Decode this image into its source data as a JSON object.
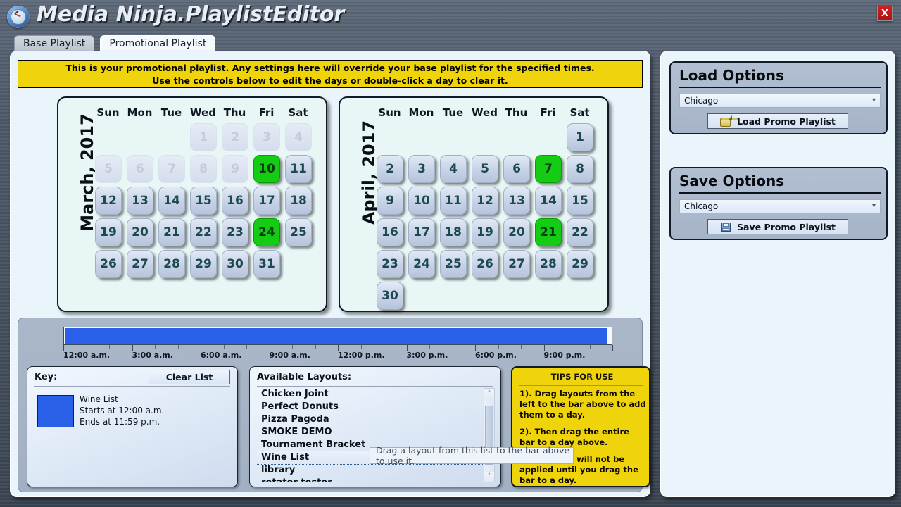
{
  "window": {
    "title": "Media Ninja.PlaylistEditor",
    "app_icon": "clock-icon",
    "close_label": "X"
  },
  "tabs": [
    {
      "label": "Base Playlist",
      "active": false
    },
    {
      "label": "Promotional Playlist",
      "active": true
    }
  ],
  "notice": {
    "line1": "This is your promotional playlist. Any settings here will override your base playlist for the specified times.",
    "line2": "Use the controls below to edit the days or double-click a day to clear it.",
    "background": "#efd40b"
  },
  "calendars": [
    {
      "month_label": "March, 2017",
      "weekday_headers": [
        "Sun",
        "Mon",
        "Tue",
        "Wed",
        "Thu",
        "Fri",
        "Sat"
      ],
      "lead_blanks": 3,
      "days": [
        {
          "n": 1,
          "state": "disabled"
        },
        {
          "n": 2,
          "state": "disabled"
        },
        {
          "n": 3,
          "state": "disabled"
        },
        {
          "n": 4,
          "state": "disabled"
        },
        {
          "n": 5,
          "state": "disabled"
        },
        {
          "n": 6,
          "state": "disabled"
        },
        {
          "n": 7,
          "state": "disabled"
        },
        {
          "n": 8,
          "state": "disabled"
        },
        {
          "n": 9,
          "state": "disabled"
        },
        {
          "n": 10,
          "state": "selected"
        },
        {
          "n": 11,
          "state": "normal"
        },
        {
          "n": 12,
          "state": "normal"
        },
        {
          "n": 13,
          "state": "normal"
        },
        {
          "n": 14,
          "state": "normal"
        },
        {
          "n": 15,
          "state": "normal"
        },
        {
          "n": 16,
          "state": "normal"
        },
        {
          "n": 17,
          "state": "normal"
        },
        {
          "n": 18,
          "state": "normal"
        },
        {
          "n": 19,
          "state": "normal"
        },
        {
          "n": 20,
          "state": "normal"
        },
        {
          "n": 21,
          "state": "normal"
        },
        {
          "n": 22,
          "state": "normal"
        },
        {
          "n": 23,
          "state": "normal"
        },
        {
          "n": 24,
          "state": "selected"
        },
        {
          "n": 25,
          "state": "normal"
        },
        {
          "n": 26,
          "state": "normal"
        },
        {
          "n": 27,
          "state": "normal"
        },
        {
          "n": 28,
          "state": "normal"
        },
        {
          "n": 29,
          "state": "normal"
        },
        {
          "n": 30,
          "state": "normal"
        },
        {
          "n": 31,
          "state": "normal"
        }
      ]
    },
    {
      "month_label": "April, 2017",
      "weekday_headers": [
        "Sun",
        "Mon",
        "Tue",
        "Wed",
        "Thu",
        "Fri",
        "Sat"
      ],
      "lead_blanks": 6,
      "days": [
        {
          "n": 1,
          "state": "normal"
        },
        {
          "n": 2,
          "state": "normal"
        },
        {
          "n": 3,
          "state": "normal"
        },
        {
          "n": 4,
          "state": "normal"
        },
        {
          "n": 5,
          "state": "normal"
        },
        {
          "n": 6,
          "state": "normal"
        },
        {
          "n": 7,
          "state": "selected"
        },
        {
          "n": 8,
          "state": "normal"
        },
        {
          "n": 9,
          "state": "normal"
        },
        {
          "n": 10,
          "state": "normal"
        },
        {
          "n": 11,
          "state": "normal"
        },
        {
          "n": 12,
          "state": "normal"
        },
        {
          "n": 13,
          "state": "normal"
        },
        {
          "n": 14,
          "state": "normal"
        },
        {
          "n": 15,
          "state": "normal"
        },
        {
          "n": 16,
          "state": "normal"
        },
        {
          "n": 17,
          "state": "normal"
        },
        {
          "n": 18,
          "state": "normal"
        },
        {
          "n": 19,
          "state": "normal"
        },
        {
          "n": 20,
          "state": "normal"
        },
        {
          "n": 21,
          "state": "selected"
        },
        {
          "n": 22,
          "state": "normal"
        },
        {
          "n": 23,
          "state": "normal"
        },
        {
          "n": 24,
          "state": "normal"
        },
        {
          "n": 25,
          "state": "normal"
        },
        {
          "n": 26,
          "state": "normal"
        },
        {
          "n": 27,
          "state": "normal"
        },
        {
          "n": 28,
          "state": "normal"
        },
        {
          "n": 29,
          "state": "normal"
        },
        {
          "n": 30,
          "state": "normal"
        }
      ]
    }
  ],
  "timeline": {
    "fill_color": "#2a5fe8",
    "fill_percent": 99,
    "tick_labels": [
      "12:00 a.m.",
      "3:00 a.m.",
      "6:00 a.m.",
      "9:00 a.m.",
      "12:00 p.m.",
      "3:00 p.m.",
      "6:00 p.m.",
      "9:00 p.m."
    ]
  },
  "key_panel": {
    "title": "Key:",
    "clear_button": "Clear List",
    "entry": {
      "swatch_color": "#2a5fe8",
      "name": "Wine List",
      "starts": "Starts at 12:00 a.m.",
      "ends": "Ends at 11:59 p.m."
    }
  },
  "layouts_panel": {
    "title": "Available Layouts:",
    "items": [
      {
        "label": "Chicken Joint",
        "selected": false
      },
      {
        "label": "Perfect Donuts",
        "selected": false
      },
      {
        "label": "Pizza Pagoda",
        "selected": false
      },
      {
        "label": "SMOKE DEMO",
        "selected": false
      },
      {
        "label": "Tournament Bracket",
        "selected": false
      },
      {
        "label": "Wine List",
        "selected": true
      },
      {
        "label": "library",
        "selected": false
      },
      {
        "label": "rotator tester",
        "selected": false
      }
    ],
    "scroll_up": "˄",
    "scroll_down": "˅"
  },
  "tooltip": {
    "text": "Drag a layout from this list to the bar above to use it."
  },
  "tips_panel": {
    "title": "TIPS FOR USE",
    "items": [
      "1). Drag layouts from the left to the bar above to add them to a day.",
      "2). Then drag the entire bar to a day above.",
      "3). Changes will not be applied until you drag the bar to a day."
    ]
  },
  "sidebar": {
    "load_options": {
      "title": "Load Options",
      "combo_value": "Chicago",
      "button_label": "Load Promo Playlist",
      "button_icon": "folder-open-icon"
    },
    "save_options": {
      "title": "Save Options",
      "combo_value": "Chicago",
      "button_label": "Save Promo Playlist",
      "button_icon": "floppy-disk-icon"
    }
  }
}
